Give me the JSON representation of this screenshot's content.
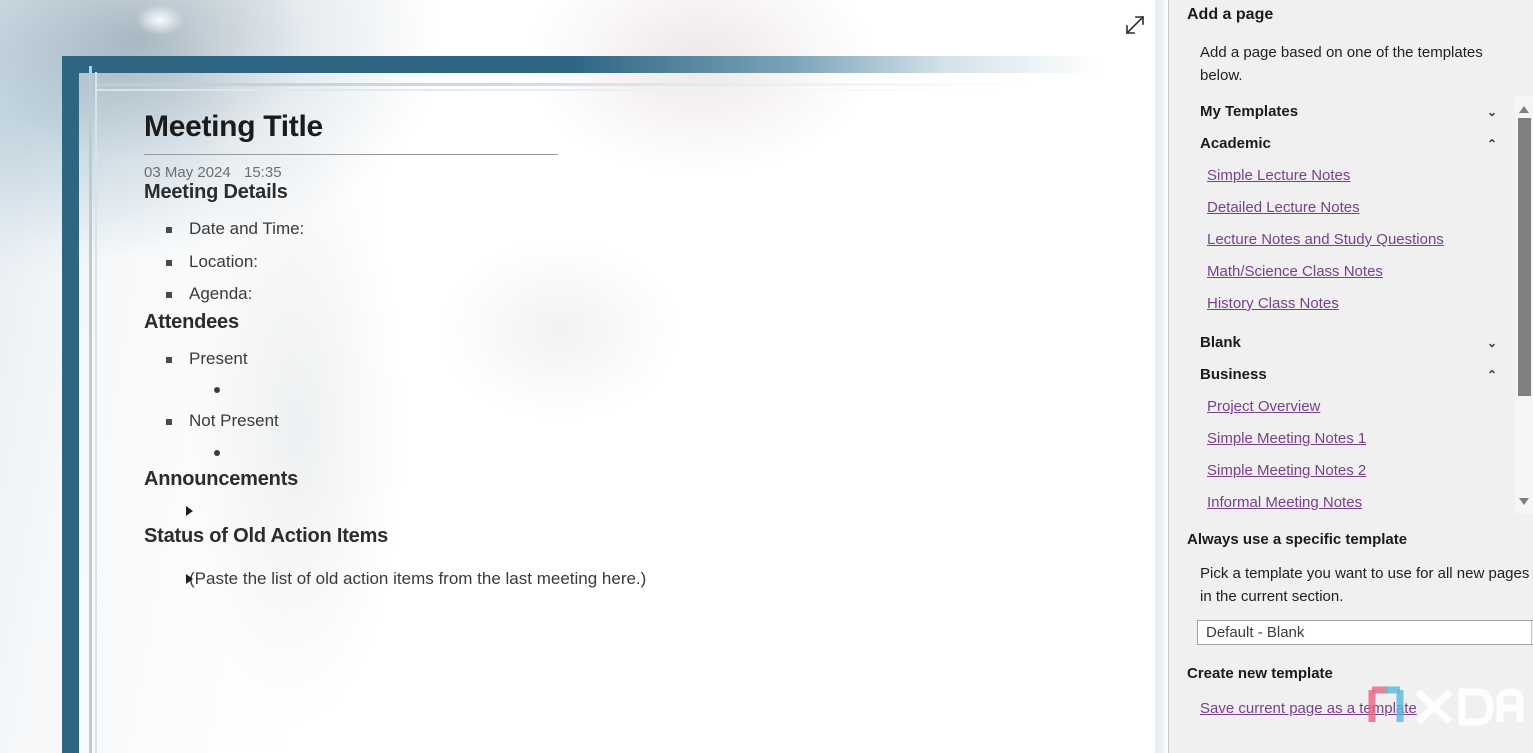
{
  "note": {
    "title": "Meeting Title",
    "date": "03 May 2024",
    "time": "15:35",
    "sections": {
      "meeting_details": {
        "heading": "Meeting Details",
        "items": [
          "Date and Time:",
          "Location:",
          "Agenda:"
        ]
      },
      "attendees": {
        "heading": "Attendees",
        "present_label": "Present",
        "not_present_label": "Not Present"
      },
      "announcements": {
        "heading": "Announcements"
      },
      "status": {
        "heading": "Status of Old Action Items",
        "item": "(Paste the list of old action items from the last meeting here.)"
      }
    },
    "expand_icon": "expand-diagonal-icon",
    "frame_color": "#2d6583"
  },
  "panel": {
    "title": "Add a page",
    "description": "Add a page based on one of the templates below.",
    "groups": [
      {
        "name": "My Templates",
        "expanded": false,
        "chevron": "⌄",
        "items": []
      },
      {
        "name": "Academic",
        "expanded": true,
        "chevron": "⌃",
        "items": [
          "Simple Lecture Notes",
          "Detailed Lecture Notes",
          "Lecture Notes and Study Questions",
          "Math/Science Class Notes",
          "History Class Notes"
        ]
      },
      {
        "name": "Blank",
        "expanded": false,
        "chevron": "⌄",
        "items": []
      },
      {
        "name": "Business",
        "expanded": true,
        "chevron": "⌃",
        "items": [
          "Project Overview",
          "Simple Meeting Notes 1",
          "Simple Meeting Notes 2",
          "Informal Meeting Notes"
        ]
      }
    ],
    "always_heading": "Always use a specific template",
    "always_description": "Pick a template you want to use for all new pages in the current section.",
    "template_select_value": "Default - Blank",
    "create_heading": "Create new template",
    "save_link": "Save current page as a template",
    "link_color": "#7a3f8f",
    "background": "#f0f0f0",
    "scrollbar": {
      "up_icon": "scroll-up-arrow-icon",
      "down_icon": "scroll-down-arrow-icon",
      "thumb": "scrollbar-thumb"
    }
  },
  "watermark": {
    "text": "XDA"
  }
}
